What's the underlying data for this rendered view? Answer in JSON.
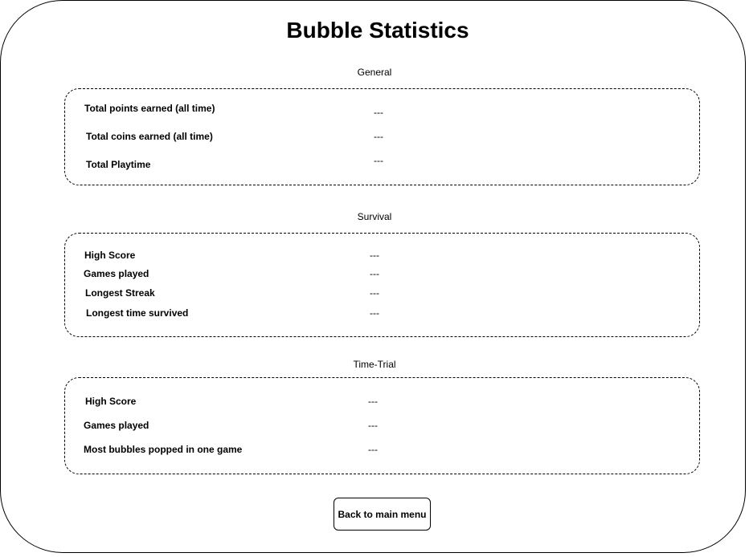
{
  "page": {
    "title": "Bubble Statistics"
  },
  "general": {
    "heading": "General",
    "rows": [
      {
        "label": "Total points earned (all time)",
        "value": "---"
      },
      {
        "label": "Total coins earned (all time)",
        "value": "---"
      },
      {
        "label": "Total Playtime",
        "value": "---"
      }
    ]
  },
  "survival": {
    "heading": "Survival",
    "rows": [
      {
        "label": "High Score",
        "value": "---"
      },
      {
        "label": "Games played",
        "value": "---"
      },
      {
        "label": "Longest Streak",
        "value": "---"
      },
      {
        "label": "Longest time survived",
        "value": "---"
      }
    ]
  },
  "time_trial": {
    "heading": "Time-Trial",
    "rows": [
      {
        "label": "High Score",
        "value": "---"
      },
      {
        "label": "Games played",
        "value": "---"
      },
      {
        "label": "Most bubbles popped in one game",
        "value": "---"
      }
    ]
  },
  "actions": {
    "back_label": "Back to main menu"
  }
}
